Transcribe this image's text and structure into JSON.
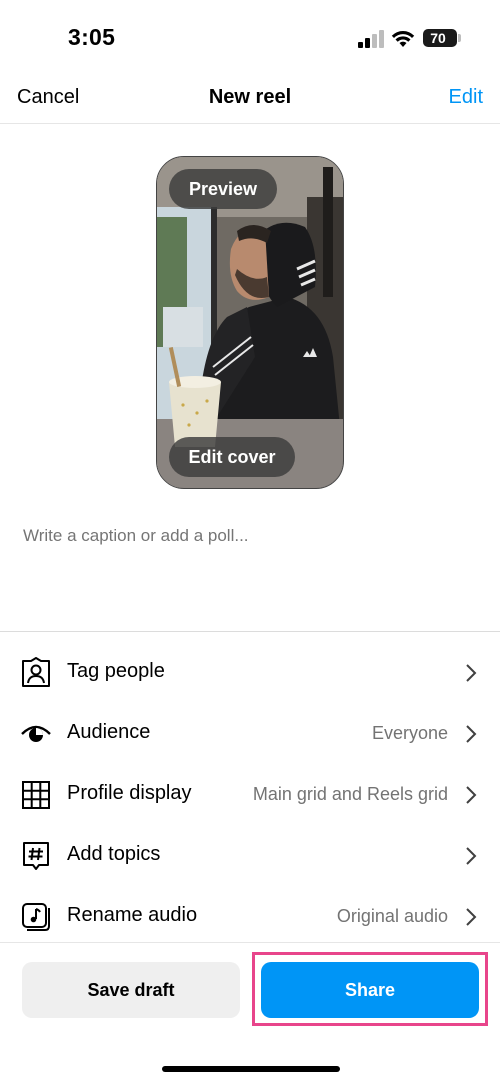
{
  "status_bar": {
    "time": "3:05",
    "battery": "70"
  },
  "header": {
    "cancel_label": "Cancel",
    "title": "New reel",
    "edit_label": "Edit"
  },
  "preview": {
    "preview_label": "Preview",
    "edit_cover_label": "Edit cover"
  },
  "caption": {
    "placeholder": "Write a caption or add a poll..."
  },
  "options": [
    {
      "label": "Tag people",
      "value": "",
      "icon": "tag-people-icon"
    },
    {
      "label": "Audience",
      "value": "Everyone",
      "icon": "audience-eye-icon"
    },
    {
      "label": "Profile display",
      "value": "Main grid and Reels grid",
      "icon": "grid-icon"
    },
    {
      "label": "Add topics",
      "value": "",
      "icon": "hashtag-icon"
    },
    {
      "label": "Rename audio",
      "value": "Original audio",
      "icon": "music-note-icon"
    }
  ],
  "footer": {
    "save_draft_label": "Save draft",
    "share_label": "Share"
  },
  "colors": {
    "accent": "#0095f6",
    "highlight": "#e8458b",
    "secondary_text": "#737373"
  }
}
